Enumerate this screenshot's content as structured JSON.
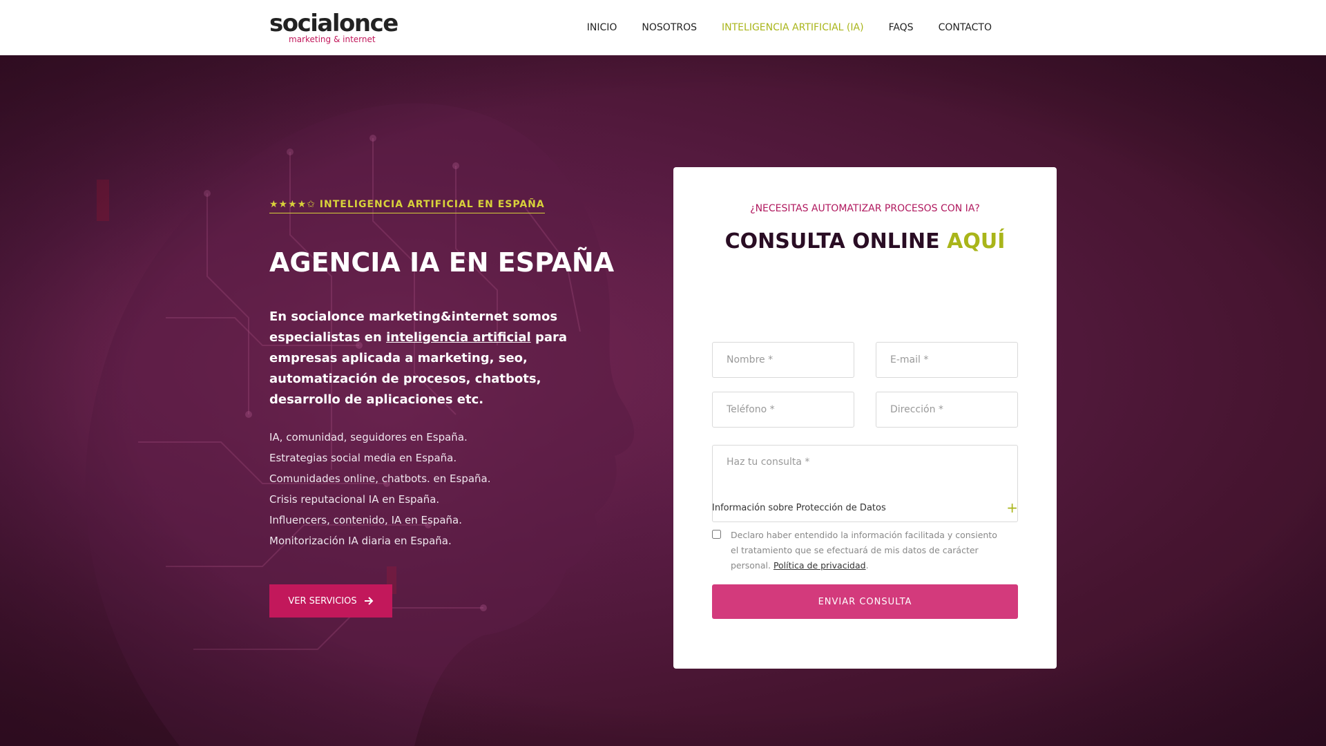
{
  "header": {
    "logo": {
      "name": "socialonce",
      "tagline": "marketing & internet"
    },
    "nav": [
      {
        "label": "INICIO"
      },
      {
        "label": "NOSOTROS"
      },
      {
        "label": "INTELIGENCIA ARTIFICIAL (IA)",
        "active": true
      },
      {
        "label": "FAQS"
      },
      {
        "label": "CONTACTO"
      }
    ]
  },
  "hero": {
    "eyebrow": "★★★★✩ INTELIGENCIA ARTIFICIAL EN ESPAÑA",
    "title": "AGENCIA IA EN ESPAÑA",
    "lead_before": "En socialonce marketing&internet somos especialistas en ",
    "lead_link": "inteligencia artificial",
    "lead_after": " para empresas aplicada a marketing, seo, automatización de procesos, chatbots, desarrollo de aplicaciones etc.",
    "features": [
      "IA, comunidad, seguidores en España.",
      "Estrategias social media en España.",
      "Comunidades online, chatbots. en España.",
      "Crisis reputacional IA en España.",
      "Influencers, contenido, IA en España.",
      "Monitorización IA diaria en España."
    ],
    "button_label": "VER SERVICIOS",
    "button_icon": "arrow-right-icon"
  },
  "form": {
    "eyebrow": "¿NECESITAS AUTOMATIZAR PROCESOS CON IA?",
    "title_main": "CONSULTA ONLINE",
    "title_accent": "AQUÍ",
    "fields": {
      "nombre": {
        "placeholder": "Nombre *",
        "value": ""
      },
      "email": {
        "placeholder": "E-mail *",
        "value": ""
      },
      "telefono": {
        "placeholder": "Teléfono *",
        "value": ""
      },
      "direccion": {
        "placeholder": "Dirección *",
        "value": ""
      },
      "consulta": {
        "placeholder": "Haz tu consulta *",
        "value": ""
      }
    },
    "privacy_label": "Información sobre Protección de Datos",
    "privacy_icon": "plus-icon",
    "consent_text": "Declaro haber entendido la información facilitada y consiento el tratamiento que se efectuará de mis datos de carácter personal. ",
    "consent_link": "Política de privacidad",
    "consent_end": ".",
    "consent_checked": false,
    "submit_label": "ENVIAR CONSULTA"
  },
  "colors": {
    "brand": "#c2185b",
    "accent": "#a9b51a",
    "eyebrow": "#d8d23a",
    "hero_bg": "#4a1436",
    "submit": "#d33a7c"
  }
}
